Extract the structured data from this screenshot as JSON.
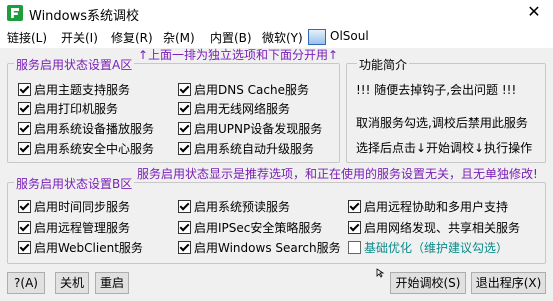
{
  "window": {
    "title": "Windows系统调校",
    "close_icon": "✕"
  },
  "menu": {
    "items": [
      "链接(L)",
      "开关(I)",
      "修复(R)",
      "杂(M)",
      "内置(B)",
      "微软(Y)"
    ],
    "olsoul_label": "OlSoul"
  },
  "notes": {
    "top": "↑上面一排为独立选项和下面分开用↑",
    "middle": "服务启用状态显示是推荐选项，和正在使用的服务设置无关，且无单独修改!"
  },
  "group_a": {
    "title": "服务启用状态设置A区",
    "items": [
      {
        "label": "启用主题支持服务",
        "checked": true
      },
      {
        "label": "启用DNS Cache服务",
        "checked": true
      },
      {
        "label": "启用打印机服务",
        "checked": true
      },
      {
        "label": "启用无线网络服务",
        "checked": true
      },
      {
        "label": "启用系统设备播放服务",
        "checked": true
      },
      {
        "label": "启用UPNP设备发现服务",
        "checked": true
      },
      {
        "label": "启用系统安全中心服务",
        "checked": true
      },
      {
        "label": "启用系统自动升级服务",
        "checked": true
      }
    ]
  },
  "intro": {
    "title": "功能简介",
    "line1": "!!! 随便去掉钩子,会出问题 !!!",
    "line2": "取消服务勾选,调校后禁用此服务",
    "line3": "选择后点击↓开始调校↓执行操作"
  },
  "group_b": {
    "title": "服务启用状态设置B区",
    "items": [
      {
        "label": "启用时间同步服务",
        "checked": true
      },
      {
        "label": "启用系统预读服务",
        "checked": true
      },
      {
        "label": "启用远程协助和多用户支持",
        "checked": true
      },
      {
        "label": "启用远程管理服务",
        "checked": true
      },
      {
        "label": "启用IPSec安全策略服务",
        "checked": true
      },
      {
        "label": "启用网络发现、共享相关服务",
        "checked": true
      },
      {
        "label": "启用WebClient服务",
        "checked": true
      },
      {
        "label": "启用Windows Search服务",
        "checked": true
      },
      {
        "label": "基础优化（维护建议勾选）",
        "checked": false
      }
    ]
  },
  "buttons": {
    "help": "?(A)",
    "shutdown": "关机",
    "restart": "重启",
    "start": "开始调校(S)",
    "exit": "退出程序(X)"
  }
}
